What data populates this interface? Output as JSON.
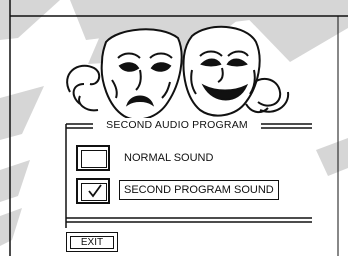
{
  "menu": {
    "title": "SECOND AUDIO PROGRAM",
    "options": [
      {
        "label": "NORMAL SOUND",
        "checked": false
      },
      {
        "label": "SECOND PROGRAM SOUND",
        "checked": true
      }
    ],
    "exit_label": "EXIT"
  },
  "icons": {
    "background": "theater-masks-icon",
    "checkmark": "checkmark-icon"
  },
  "colors": {
    "ink": "#111111",
    "background": "#ffffff",
    "gray_shape": "#d6d6d6"
  }
}
